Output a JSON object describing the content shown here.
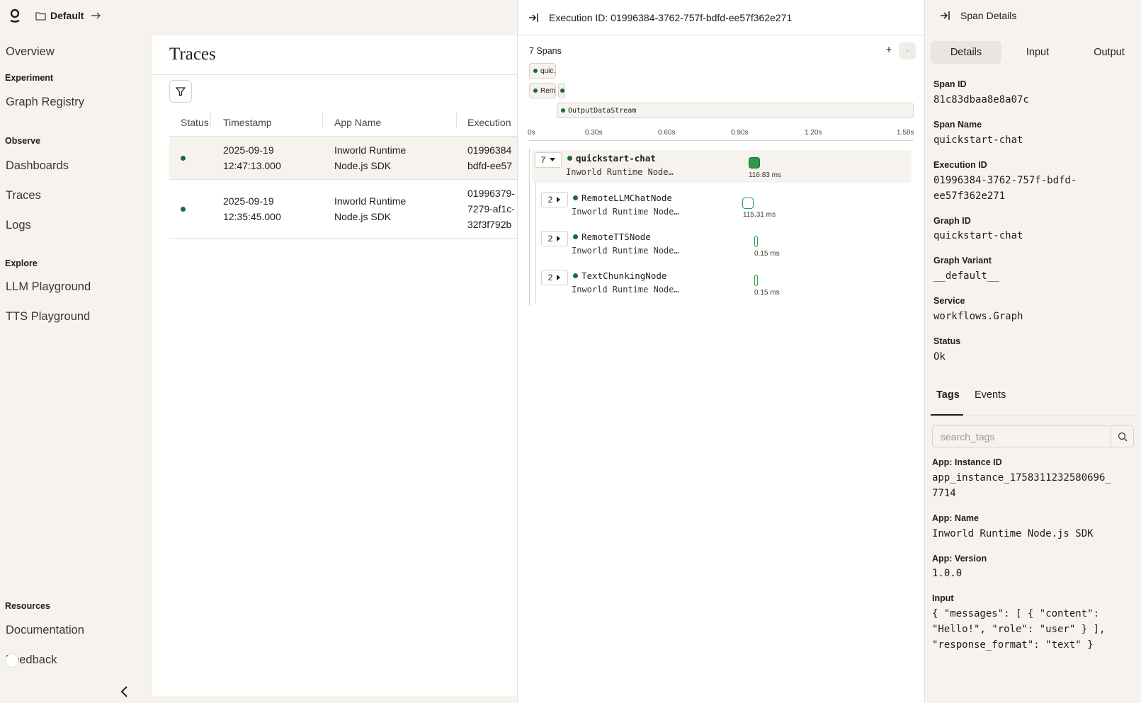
{
  "topbar": {
    "workspace": "Default"
  },
  "sidebar": {
    "overview": "Overview",
    "sections": {
      "experiment": "Experiment",
      "observe": "Observe",
      "explore": "Explore",
      "resources": "Resources"
    },
    "items": {
      "graph_registry": "Graph Registry",
      "dashboards": "Dashboards",
      "traces": "Traces",
      "logs": "Logs",
      "llm_playground": "LLM Playground",
      "tts_playground": "TTS Playground",
      "documentation": "Documentation",
      "feedback": "Feedback"
    }
  },
  "traces": {
    "title": "Traces",
    "columns": [
      "Status",
      "Timestamp",
      "App Name",
      "Execution"
    ],
    "rows": [
      {
        "timestamp_date": "2025-09-19",
        "timestamp_time": "12:47:13.000",
        "app_line1": "Inworld Runtime",
        "app_line2": "Node.js SDK",
        "exec_line1": "01996384",
        "exec_line2": "bdfd-ee57",
        "exec_line3": ""
      },
      {
        "timestamp_date": "2025-09-19",
        "timestamp_time": "12:35:45.000",
        "app_line1": "Inworld Runtime",
        "app_line2": "Node.js SDK",
        "exec_line1": "01996379-",
        "exec_line2": "7279-af1c-",
        "exec_line3": "32f3f792b"
      }
    ]
  },
  "execution": {
    "title": "Execution ID: 01996384-3762-757f-bdfd-ee57f362e271",
    "spans_count": "7 Spans",
    "zoom_in": "+",
    "zoom_out": "-",
    "minimap": [
      "quic…",
      "Remo",
      "OutputDataStream"
    ],
    "axis_ticks": [
      "0s",
      "0.30s",
      "0.60s",
      "0.90s",
      "1.20s",
      "1.58s"
    ],
    "spans": [
      {
        "count": "7",
        "name": "quickstart-chat",
        "sub": "Inworld Runtime Node…",
        "duration": "116.83 ms"
      },
      {
        "count": "2",
        "name": "RemoteLLMChatNode",
        "sub": "Inworld Runtime Node…",
        "duration": "115.31 ms"
      },
      {
        "count": "2",
        "name": "RemoteTTSNode",
        "sub": "Inworld Runtime Node…",
        "duration": "0.15 ms"
      },
      {
        "count": "2",
        "name": "TextChunkingNode",
        "sub": "Inworld Runtime Node…",
        "duration": "0.15 ms"
      }
    ]
  },
  "details": {
    "title": "Span Details",
    "tabs": [
      "Details",
      "Input",
      "Output"
    ],
    "fields": {
      "span_id_label": "Span ID",
      "span_id": "81c83dbaa8e8a07c",
      "span_name_label": "Span Name",
      "span_name": "quickstart-chat",
      "execution_id_label": "Execution ID",
      "execution_id_1": "01996384-3762-757f-bdfd-",
      "execution_id_2": "ee57f362e271",
      "graph_id_label": "Graph ID",
      "graph_id": "quickstart-chat",
      "graph_variant_label": "Graph Variant",
      "graph_variant": "__default__",
      "service_label": "Service",
      "service": "workflows.Graph",
      "status_label": "Status",
      "status": "Ok"
    },
    "subtabs": [
      "Tags",
      "Events"
    ],
    "search_placeholder": "search_tags",
    "tags": {
      "instance_label": "App: Instance ID",
      "instance_1": "app_instance_1758311232580696_",
      "instance_2": "7714",
      "name_label": "App: Name",
      "name": "Inworld Runtime Node.js SDK",
      "version_label": "App: Version",
      "version": "1.0.0",
      "input_label": "Input",
      "input_1": "{ \"messages\": [ { \"content\":",
      "input_2": "\"Hello!\", \"role\": \"user\" } ],",
      "input_3": "\"response_format\": \"text\" }"
    }
  }
}
